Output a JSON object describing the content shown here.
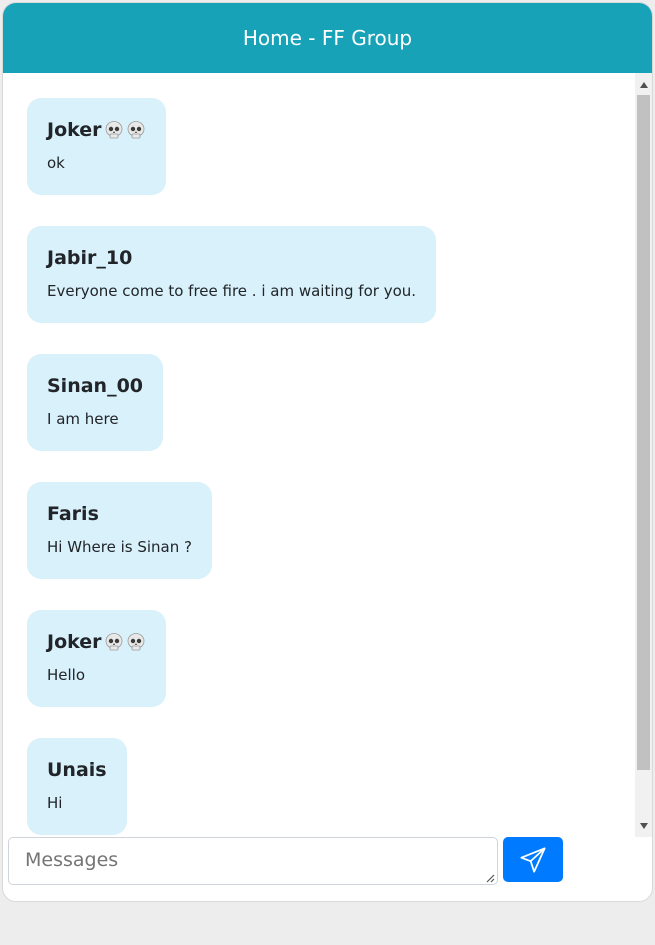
{
  "header": {
    "title": "Home - FF Group"
  },
  "messages": [
    {
      "sender": "Joker",
      "emoji_count": 2,
      "text": "ok"
    },
    {
      "sender": "Jabir_10",
      "emoji_count": 0,
      "text": "Everyone come to free fire . i am waiting for you."
    },
    {
      "sender": "Sinan_00",
      "emoji_count": 0,
      "text": "I am here"
    },
    {
      "sender": "Faris",
      "emoji_count": 0,
      "text": "Hi Where is Sinan ?"
    },
    {
      "sender": "Joker",
      "emoji_count": 2,
      "text": "Hello"
    },
    {
      "sender": "Unais",
      "emoji_count": 0,
      "text": "Hi"
    }
  ],
  "composer": {
    "placeholder": "Messages",
    "send_icon": "send-paper-plane-icon"
  },
  "colors": {
    "header_bg": "#17a2b8",
    "bubble_bg": "#d9f1fb",
    "send_button": "#007bff",
    "page_bg": "#ededed"
  }
}
